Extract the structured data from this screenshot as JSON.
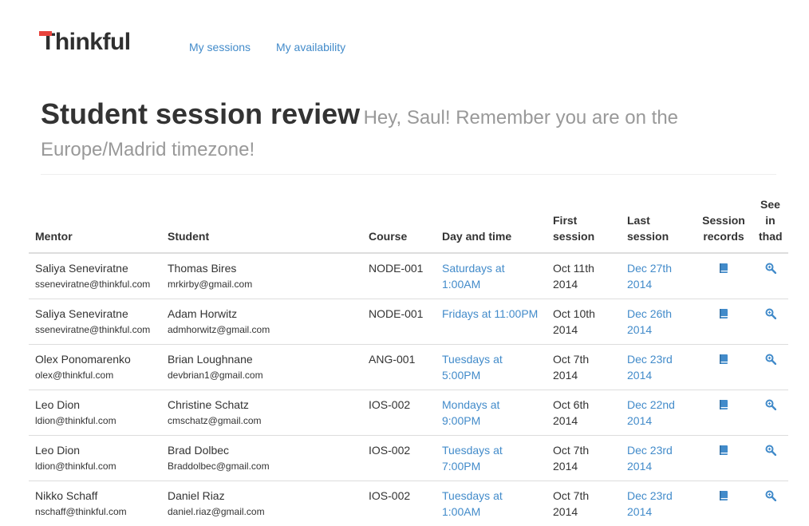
{
  "brand": {
    "name": "Thinkful",
    "accent": "#e8433d"
  },
  "nav": {
    "my_sessions": "My sessions",
    "my_availability": "My availability"
  },
  "header": {
    "title": "Student session review",
    "subtitle": "Hey, Saul! Remember you are on the Europe/Madrid timezone!"
  },
  "table": {
    "headers": {
      "mentor": "Mentor",
      "student": "Student",
      "course": "Course",
      "day_time": "Day and time",
      "first_session": "First session",
      "last_session": "Last session",
      "session_records": "Session records",
      "see_in_thad": "See in thad"
    },
    "rows": [
      {
        "mentor_name": "Saliya Seneviratne",
        "mentor_email": "sseneviratne@thinkful.com",
        "student_name": "Thomas Bires",
        "student_email": "mrkirby@gmail.com",
        "course": "NODE-001",
        "day_time": "Saturdays at 1:00AM",
        "first_session": "Oct 11th 2014",
        "last_session": "Dec 27th 2014"
      },
      {
        "mentor_name": "Saliya Seneviratne",
        "mentor_email": "sseneviratne@thinkful.com",
        "student_name": "Adam Horwitz",
        "student_email": "admhorwitz@gmail.com",
        "course": "NODE-001",
        "day_time": "Fridays at 11:00PM",
        "first_session": "Oct 10th 2014",
        "last_session": "Dec 26th 2014"
      },
      {
        "mentor_name": "Olex Ponomarenko",
        "mentor_email": "olex@thinkful.com",
        "student_name": "Brian Loughnane",
        "student_email": "devbrian1@gmail.com",
        "course": "ANG-001",
        "day_time": "Tuesdays at 5:00PM",
        "first_session": "Oct 7th 2014",
        "last_session": "Dec 23rd 2014"
      },
      {
        "mentor_name": "Leo Dion",
        "mentor_email": "ldion@thinkful.com",
        "student_name": "Christine Schatz",
        "student_email": "cmschatz@gmail.com",
        "course": "IOS-002",
        "day_time": "Mondays at 9:00PM",
        "first_session": "Oct 6th 2014",
        "last_session": "Dec 22nd 2014"
      },
      {
        "mentor_name": "Leo Dion",
        "mentor_email": "ldion@thinkful.com",
        "student_name": "Brad Dolbec",
        "student_email": "Braddolbec@gmail.com",
        "course": "IOS-002",
        "day_time": "Tuesdays at 7:00PM",
        "first_session": "Oct 7th 2014",
        "last_session": "Dec 23rd 2014"
      },
      {
        "mentor_name": "Nikko Schaff",
        "mentor_email": "nschaff@thinkful.com",
        "student_name": "Daniel Riaz",
        "student_email": "daniel.riaz@gmail.com",
        "course": "IOS-002",
        "day_time": "Tuesdays at 1:00AM",
        "first_session": "Oct 7th 2014",
        "last_session": "Dec 23rd 2014"
      }
    ],
    "icons": {
      "records": "book-icon",
      "thad": "magnifier-icon"
    }
  }
}
